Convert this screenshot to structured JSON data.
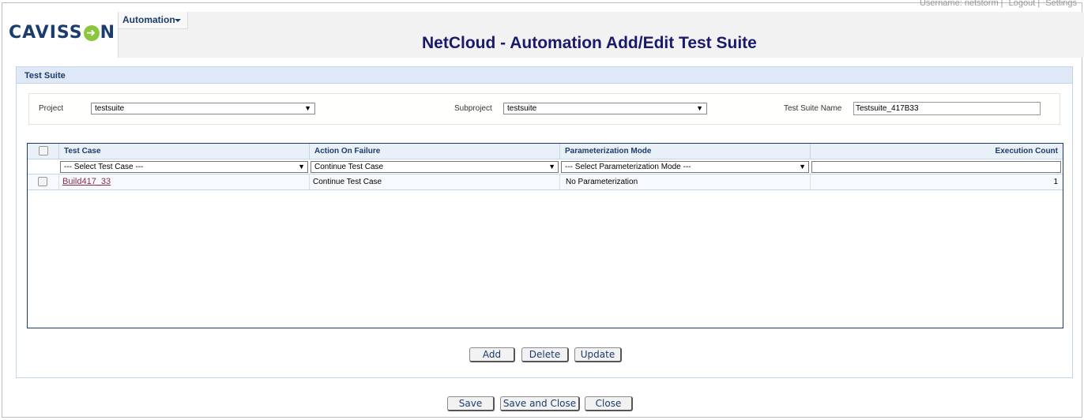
{
  "userbar": {
    "username": "Username: netstorm",
    "logout": "Logout",
    "settings": "Settings"
  },
  "logo": {
    "text_before": "CAVISS",
    "o_glyph": "➜",
    "text_after": "N"
  },
  "menu": {
    "automation": "Automation"
  },
  "page_title": "NetCloud - Automation Add/Edit Test Suite",
  "panel_title": "Test Suite",
  "filters": {
    "project_label": "Project",
    "project_value": "testsuite",
    "subproject_label": "Subproject",
    "subproject_value": "testsuite",
    "suite_name_label": "Test Suite Name",
    "suite_name_value": "Testsuite_417B33"
  },
  "grid": {
    "headers": [
      "Test Case",
      "Action On Failure",
      "Parameterization Mode",
      "Execution Count"
    ],
    "filter_row": {
      "test_case": "--- Select Test Case ---",
      "action": "Continue Test Case",
      "param_mode": "--- Select Parameterization Mode ---",
      "exec_count": ""
    },
    "rows": [
      {
        "test_case": "Build417_33",
        "action": "Continue Test Case",
        "param_mode": "No Parameterization",
        "exec_count": "1"
      }
    ]
  },
  "grid_buttons": {
    "add": "Add",
    "delete": "Delete",
    "update": "Update"
  },
  "footer_buttons": {
    "save": "Save",
    "save_close": "Save and Close",
    "close": "Close"
  },
  "dropdown_arrow": "▼"
}
